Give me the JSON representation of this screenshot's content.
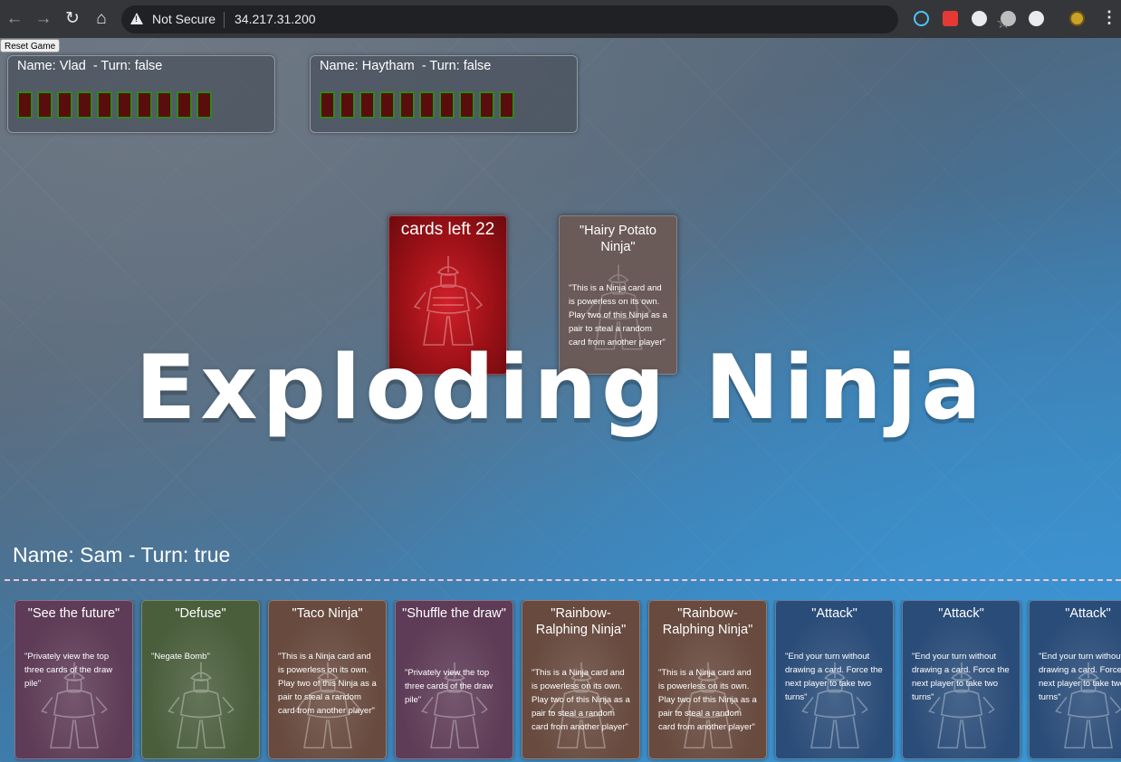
{
  "browser": {
    "security_status": "Not Secure",
    "url": "34.217.31.200",
    "nav_icons": [
      "back-icon",
      "forward-icon",
      "reload-icon",
      "home-icon"
    ],
    "extension_colors": [
      "#4fc3f7",
      "#e53935",
      "#e8eaed",
      "#bdbdbd",
      "#e8eaed",
      "#c9a227"
    ]
  },
  "game": {
    "reset_label": "Reset Game",
    "title": "Exploding Ninja",
    "opponents": [
      {
        "label": "Name: Vlad  - Turn: false",
        "card_count": 10
      },
      {
        "label": "Name: Haytham  - Turn: false",
        "card_count": 10
      }
    ],
    "deck": {
      "label": "cards left 22",
      "color": "#b01a22"
    },
    "discard": {
      "title": "\"Hairy Potato Ninja\"",
      "text": "\"This is a Ninja card and is powerless on its own. Play two of this Ninja as a pair to steal a random card from another player\"",
      "color": "#6a5a58"
    },
    "player": {
      "label": "Name: Sam - Turn: true"
    },
    "hand": [
      {
        "title": "\"See the future\"",
        "text": "\"Privately view the top three cards of the draw pile\"",
        "color": "#5e3b56"
      },
      {
        "title": "\"Defuse\"",
        "text": "\"Negate Bomb\"",
        "color": "#4a5e3c"
      },
      {
        "title": "\"Taco Ninja\"",
        "text": "\"This is a Ninja card and is powerless on its own. Play two of this Ninja as a pair to steal a random card from another player\"",
        "color": "#684a3e"
      },
      {
        "title": "\"Shuffle the draw\"",
        "text": "\"Privately view the top three cards of the draw pile\"",
        "color": "#5e3b56"
      },
      {
        "title": "\"Rainbow-Ralphing Ninja\"",
        "text": "\"This is a Ninja card and is powerless on its own. Play two of this Ninja as a pair to steal a random card from another player\"",
        "color": "#684a3e"
      },
      {
        "title": "\"Rainbow-Ralphing Ninja\"",
        "text": "\"This is a Ninja card and is powerless on its own. Play two of this Ninja as a pair to steal a random card from another player\"",
        "color": "#684a3e"
      },
      {
        "title": "\"Attack\"",
        "text": "\"End your turn without drawing a card. Force the next player to take two turns\"",
        "color": "#2a4c78"
      },
      {
        "title": "\"Attack\"",
        "text": "\"End your turn without drawing a card. Force the next player to take two turns\"",
        "color": "#2a4c78"
      },
      {
        "title": "\"Attack\"",
        "text": "\"End your turn without drawing a card. Force the next player to take two turns\"",
        "color": "#2a4c78"
      }
    ]
  }
}
